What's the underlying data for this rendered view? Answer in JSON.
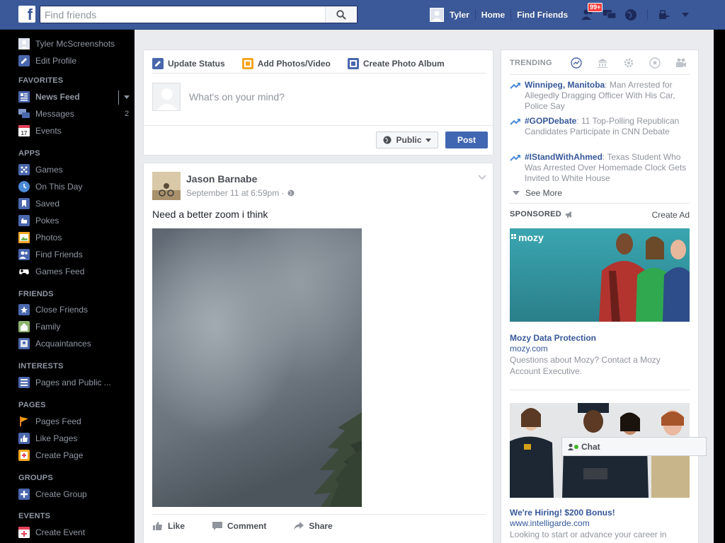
{
  "topbar": {
    "logo": "f",
    "search_placeholder": "Find friends",
    "user_name": "Tyler",
    "home": "Home",
    "find_friends": "Find Friends",
    "friend_requests_badge": "99+"
  },
  "sidebar": {
    "profile_name": "Tyler McScreenshots",
    "edit_profile": "Edit Profile",
    "favorites_head": "FAVORITES",
    "news_feed": "News Feed",
    "messages": "Messages",
    "messages_count": "2",
    "events": "Events",
    "apps_head": "APPS",
    "games": "Games",
    "on_this_day": "On This Day",
    "saved": "Saved",
    "pokes": "Pokes",
    "photos": "Photos",
    "find_friends": "Find Friends",
    "games_feed": "Games Feed",
    "friends_head": "FRIENDS",
    "close_friends": "Close Friends",
    "family": "Family",
    "acquaintances": "Acquaintances",
    "interests_head": "INTERESTS",
    "pages_public": "Pages and Public ...",
    "pages_head": "PAGES",
    "pages_feed": "Pages Feed",
    "like_pages": "Like Pages",
    "create_page": "Create Page",
    "groups_head": "GROUPS",
    "create_group": "Create Group",
    "events_head": "EVENTS",
    "create_event": "Create Event"
  },
  "composer": {
    "tab_status": "Update Status",
    "tab_photos": "Add Photos/Video",
    "tab_album": "Create Photo Album",
    "placeholder": "What's on your mind?",
    "audience": "Public",
    "post_button": "Post"
  },
  "post": {
    "author": "Jason Barnabe",
    "time": "September 11 at 6:59pm ·",
    "text": "Need a better zoom i think",
    "like": "Like",
    "comment": "Comment",
    "share": "Share"
  },
  "trending": {
    "title": "TRENDING",
    "items": [
      {
        "topic": "Winnipeg, Manitoba",
        "desc": ": Man Arrested for Allegedly Dragging Officer With His Car, Police Say"
      },
      {
        "topic": "#GOPDebate",
        "desc": ": 11 Top-Polling Republican Candidates Participate in CNN Debate"
      },
      {
        "topic": "#IStandWithAhmed",
        "desc": ": Texas Student Who Was Arrested Over Homemade Clock Gets Invited to White House"
      }
    ],
    "see_more": "See More"
  },
  "sponsored": {
    "title": "SPONSORED",
    "create_ad": "Create Ad",
    "ad1": {
      "brand_overlay": "mozy",
      "title": "Mozy Data Protection",
      "url": "mozy.com",
      "desc": "Questions about Mozy? Contact a Mozy Account Executive."
    },
    "ad2": {
      "title": "We're Hiring! $200 Bonus!",
      "url": "www.intelligarde.com",
      "desc": "Looking to start or advance your career in"
    }
  },
  "chat": {
    "label": "Chat"
  },
  "colors": {
    "brand_blue": "#3b5998",
    "post_button": "#4267b2",
    "link_blue": "#365899",
    "badge_red": "#fa3e3e",
    "online_green": "#42b72a"
  }
}
